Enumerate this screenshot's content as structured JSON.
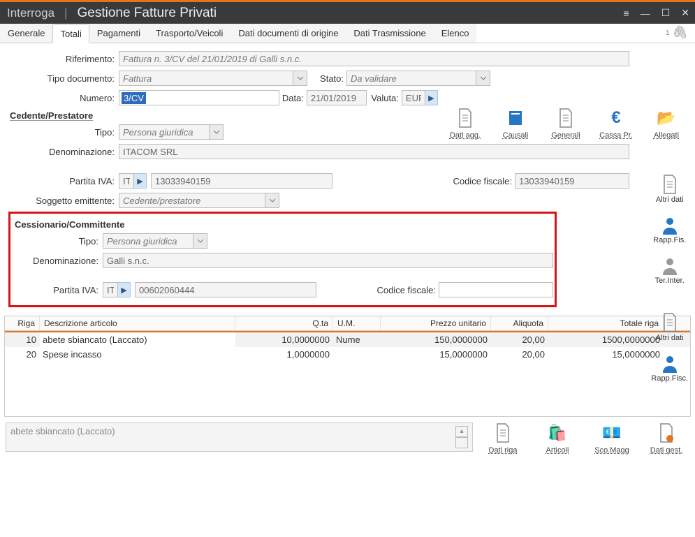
{
  "window": {
    "mode": "Interroga",
    "title": "Gestione Fatture Privati"
  },
  "tabs": [
    {
      "label": "Generale"
    },
    {
      "label": "Totali",
      "active": true
    },
    {
      "label": "Pagamenti"
    },
    {
      "label": "Trasporto/Veicoli"
    },
    {
      "label": "Dati documenti di origine"
    },
    {
      "label": "Dati Trasmissione"
    },
    {
      "label": "Elenco"
    }
  ],
  "clip_count": "1",
  "header": {
    "riferimento_label": "Riferimento:",
    "riferimento": "Fattura n. 3/CV del 21/01/2019 di Galli s.n.c.",
    "tipo_doc_label": "Tipo documento:",
    "tipo_doc": "Fattura",
    "stato_label": "Stato:",
    "stato": "Da validare",
    "numero_label": "Numero:",
    "numero": "3/CV",
    "data_label": "Data:",
    "data": "21/01/2019",
    "valuta_label": "Valuta:",
    "valuta": "EUR"
  },
  "toolbar": [
    {
      "id": "dati-agg",
      "caption": "Dati agg."
    },
    {
      "id": "causali",
      "caption": "Causali"
    },
    {
      "id": "generali",
      "caption": "Generali"
    },
    {
      "id": "cassa-pr",
      "caption": "Cassa Pr."
    },
    {
      "id": "allegati",
      "caption": "Allegati"
    }
  ],
  "cedente": {
    "section": "Cedente/Prestatore",
    "tipo_label": "Tipo:",
    "tipo": "Persona giuridica",
    "denom_label": "Denominazione:",
    "denom": "ITACOM SRL",
    "piva_label": "Partita IVA:",
    "piva_country": "IT",
    "piva": "13033940159",
    "cf_label": "Codice fiscale:",
    "cf": "13033940159",
    "sogg_label": "Soggetto emittente:",
    "sogg": "Cedente/prestatore"
  },
  "cessionario": {
    "section": "Cessionario/Committente",
    "tipo_label": "Tipo:",
    "tipo": "Persona giuridica",
    "denom_label": "Denominazione:",
    "denom": "Galli s.n.c.",
    "piva_label": "Partita IVA:",
    "piva_country": "IT",
    "piva": "00602060444",
    "cf_label": "Codice fiscale:",
    "cf": ""
  },
  "sidebar": [
    {
      "id": "altri-dati-1",
      "caption": "Altri dati",
      "icon": "doc"
    },
    {
      "id": "rapp-fis",
      "caption": "Rapp.Fis.",
      "icon": "person"
    },
    {
      "id": "ter-inter",
      "caption": "Ter.Inter.",
      "icon": "person-grey"
    },
    {
      "id": "altri-dati-2",
      "caption": "Altri dati",
      "icon": "doc"
    },
    {
      "id": "rapp-fisc",
      "caption": "Rapp.Fisc.",
      "icon": "person"
    }
  ],
  "grid": {
    "headers": {
      "riga": "Riga",
      "desc": "Descrizione articolo",
      "qta": "Q.ta",
      "um": "U.M.",
      "prezzo": "Prezzo unitario",
      "aliq": "Aliquota",
      "tot": "Totale riga"
    },
    "rows": [
      {
        "riga": "10",
        "desc": "abete sbiancato (Laccato)",
        "qta": "10,0000000",
        "um": "Nume",
        "prezzo": "150,0000000",
        "aliq": "20,00",
        "tot": "1500,0000000"
      },
      {
        "riga": "20",
        "desc": "Spese incasso",
        "qta": "1,0000000",
        "um": "",
        "prezzo": "15,0000000",
        "aliq": "20,00",
        "tot": "15,0000000"
      }
    ]
  },
  "footer": {
    "preview": "abete sbiancato (Laccato)",
    "icons": [
      {
        "id": "dati-riga",
        "caption": "Dati riga"
      },
      {
        "id": "articoli",
        "caption": "Articoli"
      },
      {
        "id": "sco-magg",
        "caption": "Sco.Magg"
      },
      {
        "id": "dati-gest",
        "caption": "Dati gest."
      }
    ]
  }
}
